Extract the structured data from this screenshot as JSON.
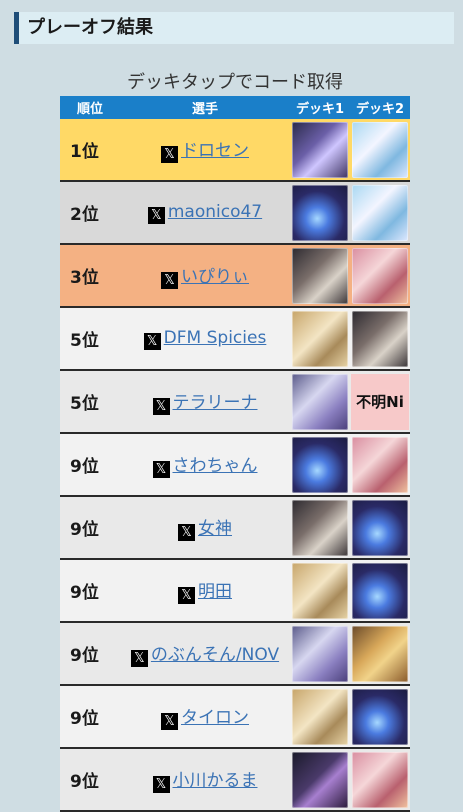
{
  "header": {
    "title": "プレーオフ結果"
  },
  "caption": "デッキタップでコード取得",
  "table": {
    "columns": [
      "順位",
      "選手",
      "デッキ1",
      "デッキ2"
    ],
    "rows": [
      {
        "rank": "1位",
        "player": "ドロセン",
        "deck1": "c-purple",
        "deck2": "c-white",
        "style": "gold"
      },
      {
        "rank": "2位",
        "player": "maonico47",
        "deck1": "c-orb",
        "deck2": "c-white",
        "style": "silver"
      },
      {
        "rank": "3位",
        "player": "いぴりぃ",
        "deck1": "c-dark",
        "deck2": "c-pink",
        "style": "bronze"
      },
      {
        "rank": "5位",
        "player": "DFM Spicies",
        "deck1": "c-gold",
        "deck2": "c-dark",
        "style": "plain"
      },
      {
        "rank": "5位",
        "player": "テラリーナ",
        "deck1": "c-silverhair",
        "deck2_text": "不明Ni",
        "style": "plain alt"
      },
      {
        "rank": "9位",
        "player": "さわちゃん",
        "deck1": "c-orb",
        "deck2": "c-pink",
        "style": "plain"
      },
      {
        "rank": "9位",
        "player": "女神",
        "deck1": "c-dark",
        "deck2": "c-orb",
        "style": "plain alt"
      },
      {
        "rank": "9位",
        "player": "明田",
        "deck1": "c-gold",
        "deck2": "c-orb",
        "style": "plain"
      },
      {
        "rank": "9位",
        "player": "のぶんそん/NOV",
        "deck1": "c-silverhair",
        "deck2": "c-amber",
        "style": "plain alt"
      },
      {
        "rank": "9位",
        "player": "タイロン",
        "deck1": "c-gold",
        "deck2": "c-orb",
        "style": "plain"
      },
      {
        "rank": "9位",
        "player": "小川かるま",
        "deck1": "c-night",
        "deck2": "c-pink",
        "style": "plain alt"
      }
    ]
  },
  "icons": {
    "x_logo": "x-logo-icon"
  }
}
